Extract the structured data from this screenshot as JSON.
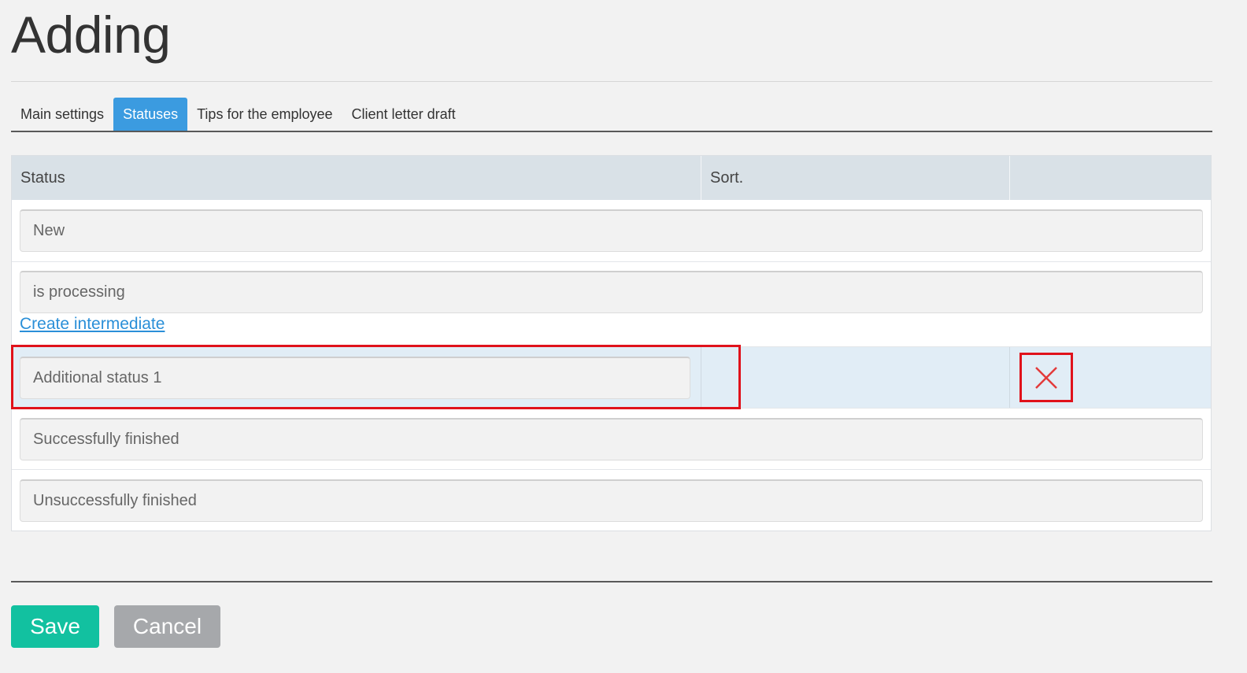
{
  "page": {
    "title": "Adding"
  },
  "tabs": [
    {
      "label": "Main settings",
      "active": false
    },
    {
      "label": "Statuses",
      "active": true
    },
    {
      "label": "Tips for the employee",
      "active": false
    },
    {
      "label": "Client letter draft",
      "active": false
    }
  ],
  "table": {
    "headers": {
      "status": "Status",
      "sort": "Sort.",
      "actions": ""
    },
    "rows": [
      {
        "value": "New"
      },
      {
        "value": "is processing"
      },
      {
        "value": "Additional status 1"
      },
      {
        "value": "Successfully finished"
      },
      {
        "value": "Unsuccessfully finished"
      }
    ],
    "create_link": "Create intermediate"
  },
  "buttons": {
    "save": "Save",
    "cancel": "Cancel"
  },
  "colors": {
    "accent": "#3b9be0",
    "save": "#12c1a0",
    "cancel": "#a6a8ab",
    "highlight_box": "#e0121b",
    "delete_icon": "#e0121b"
  },
  "icons": {
    "delete": "close-icon"
  }
}
